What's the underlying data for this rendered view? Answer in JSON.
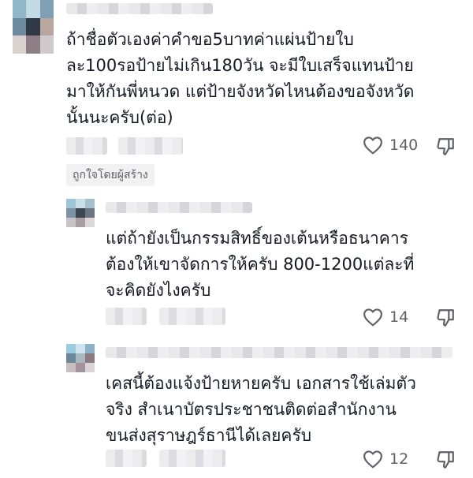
{
  "comments": [
    {
      "text": "ถ้าชื่อตัวเองค่าคำขอ5บาทค่าแผ่นป้ายใบ\nละ100รอป้ายไม่เกิน180วัน จะมีใบเสร็จแทนป้าย\nมาให้กันพี่หนวด แต่ป้ายจังหวัดไหนต้องขอจังหวัด\nนั้นนะครับ(ต่อ)",
      "likes": "140",
      "badge": "ถูกใจโดยผู้สร้าง",
      "avatar_colors": [
        "#8fb6c9",
        "#c3d9e4",
        "#7f9fb5",
        "#6e8aa0",
        "#2f3a46",
        "#b9a79e",
        "#d9d2cf",
        "#8e7f86",
        "#cfc9cc"
      ]
    },
    {
      "text": "แต่ถ้ายังเป็นกรรมสิทธิ์ของเต้นหรือธนาคาร\nต้องให้เขาจัดการให้ครับ 800-1200แต่ละที่\nจะคิดยังไงครับ",
      "likes": "14",
      "avatar_colors": [
        "#9fc6d6",
        "#c9dfe8",
        "#a5bfcc",
        "#7b93a3",
        "#3c4650",
        "#6a7580",
        "#c7c3c6",
        "#a89ea3",
        "#dcd8da"
      ]
    },
    {
      "text": "เคสนี้ต้องแจ้งป้ายหายครับ เอกสารใช้เล่มตัว\nจริง สำเนาบัตรประชาชนติดต่อสำนักงาน\nขนส่งสุราษฎร์ธานีได้เลยครับ",
      "likes": "12",
      "avatar_colors": [
        "#9ccbe0",
        "#cde4ee",
        "#8bb2c6",
        "#6d8698",
        "#a9b7c0",
        "#8a7b80",
        "#c6bec1",
        "#a2939a",
        "#d8d3d5"
      ]
    }
  ],
  "icon_color": "#5f6066"
}
